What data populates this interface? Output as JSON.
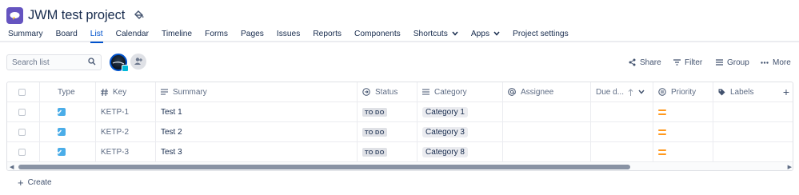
{
  "project": {
    "title": "JWM test project"
  },
  "tabs": [
    {
      "label": "Summary",
      "active": false,
      "dropdown": false
    },
    {
      "label": "Board",
      "active": false,
      "dropdown": false
    },
    {
      "label": "List",
      "active": true,
      "dropdown": false
    },
    {
      "label": "Calendar",
      "active": false,
      "dropdown": false
    },
    {
      "label": "Timeline",
      "active": false,
      "dropdown": false
    },
    {
      "label": "Forms",
      "active": false,
      "dropdown": false
    },
    {
      "label": "Pages",
      "active": false,
      "dropdown": false
    },
    {
      "label": "Issues",
      "active": false,
      "dropdown": false
    },
    {
      "label": "Reports",
      "active": false,
      "dropdown": false
    },
    {
      "label": "Components",
      "active": false,
      "dropdown": false
    },
    {
      "label": "Shortcuts",
      "active": false,
      "dropdown": true
    },
    {
      "label": "Apps",
      "active": false,
      "dropdown": true
    },
    {
      "label": "Project settings",
      "active": false,
      "dropdown": false
    }
  ],
  "toolbar": {
    "search_placeholder": "Search list",
    "share_label": "Share",
    "filter_label": "Filter",
    "group_label": "Group",
    "more_label": "More"
  },
  "table": {
    "headers": {
      "type": "Type",
      "key": "Key",
      "summary": "Summary",
      "status": "Status",
      "category": "Category",
      "assignee": "Assignee",
      "due": "Due d...",
      "priority": "Priority",
      "labels": "Labels"
    },
    "rows": [
      {
        "key": "KETP-1",
        "summary": "Test 1",
        "status": "TO DO",
        "category": "Category 1",
        "priority": "medium"
      },
      {
        "key": "KETP-2",
        "summary": "Test 2",
        "status": "TO DO",
        "category": "Category 3",
        "priority": "medium"
      },
      {
        "key": "KETP-3",
        "summary": "Test 3",
        "status": "TO DO",
        "category": "Category 8",
        "priority": "medium"
      }
    ]
  },
  "create_label": "Create",
  "colors": {
    "accent": "#0052cc",
    "project_avatar": "#6554c0",
    "task_icon": "#4bade8",
    "priority_medium": "#ff991f"
  }
}
